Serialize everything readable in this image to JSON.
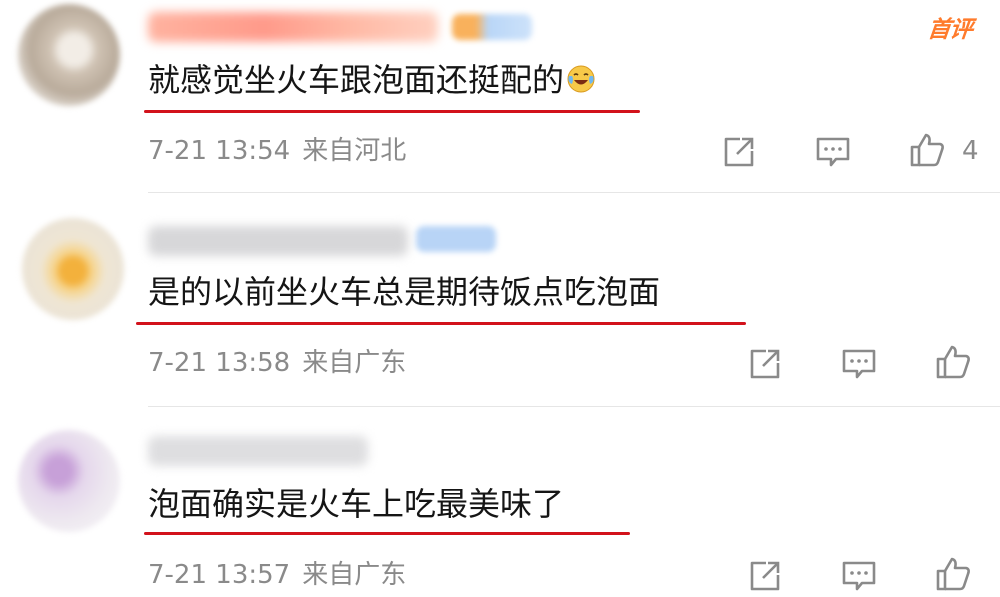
{
  "comments": [
    {
      "text": "就感觉坐火车跟泡面还挺配的",
      "time": "7-21 13:54",
      "location": "来自河北",
      "badge": "首评",
      "likes": "4",
      "emoji_icon": "laugh-cry-emoji"
    },
    {
      "text": "是的以前坐火车总是期待饭点吃泡面",
      "time": "7-21 13:58",
      "location": "来自广东"
    },
    {
      "text": "泡面确实是火车上吃最美味了",
      "time": "7-21 13:57",
      "location": "来自广东"
    }
  ],
  "colors": {
    "underline": "#d2121b",
    "badge": "#ff7b2c",
    "meta": "#8a8a8a",
    "text": "#151515"
  },
  "icons": [
    "share-icon",
    "comment-icon",
    "like-icon"
  ]
}
